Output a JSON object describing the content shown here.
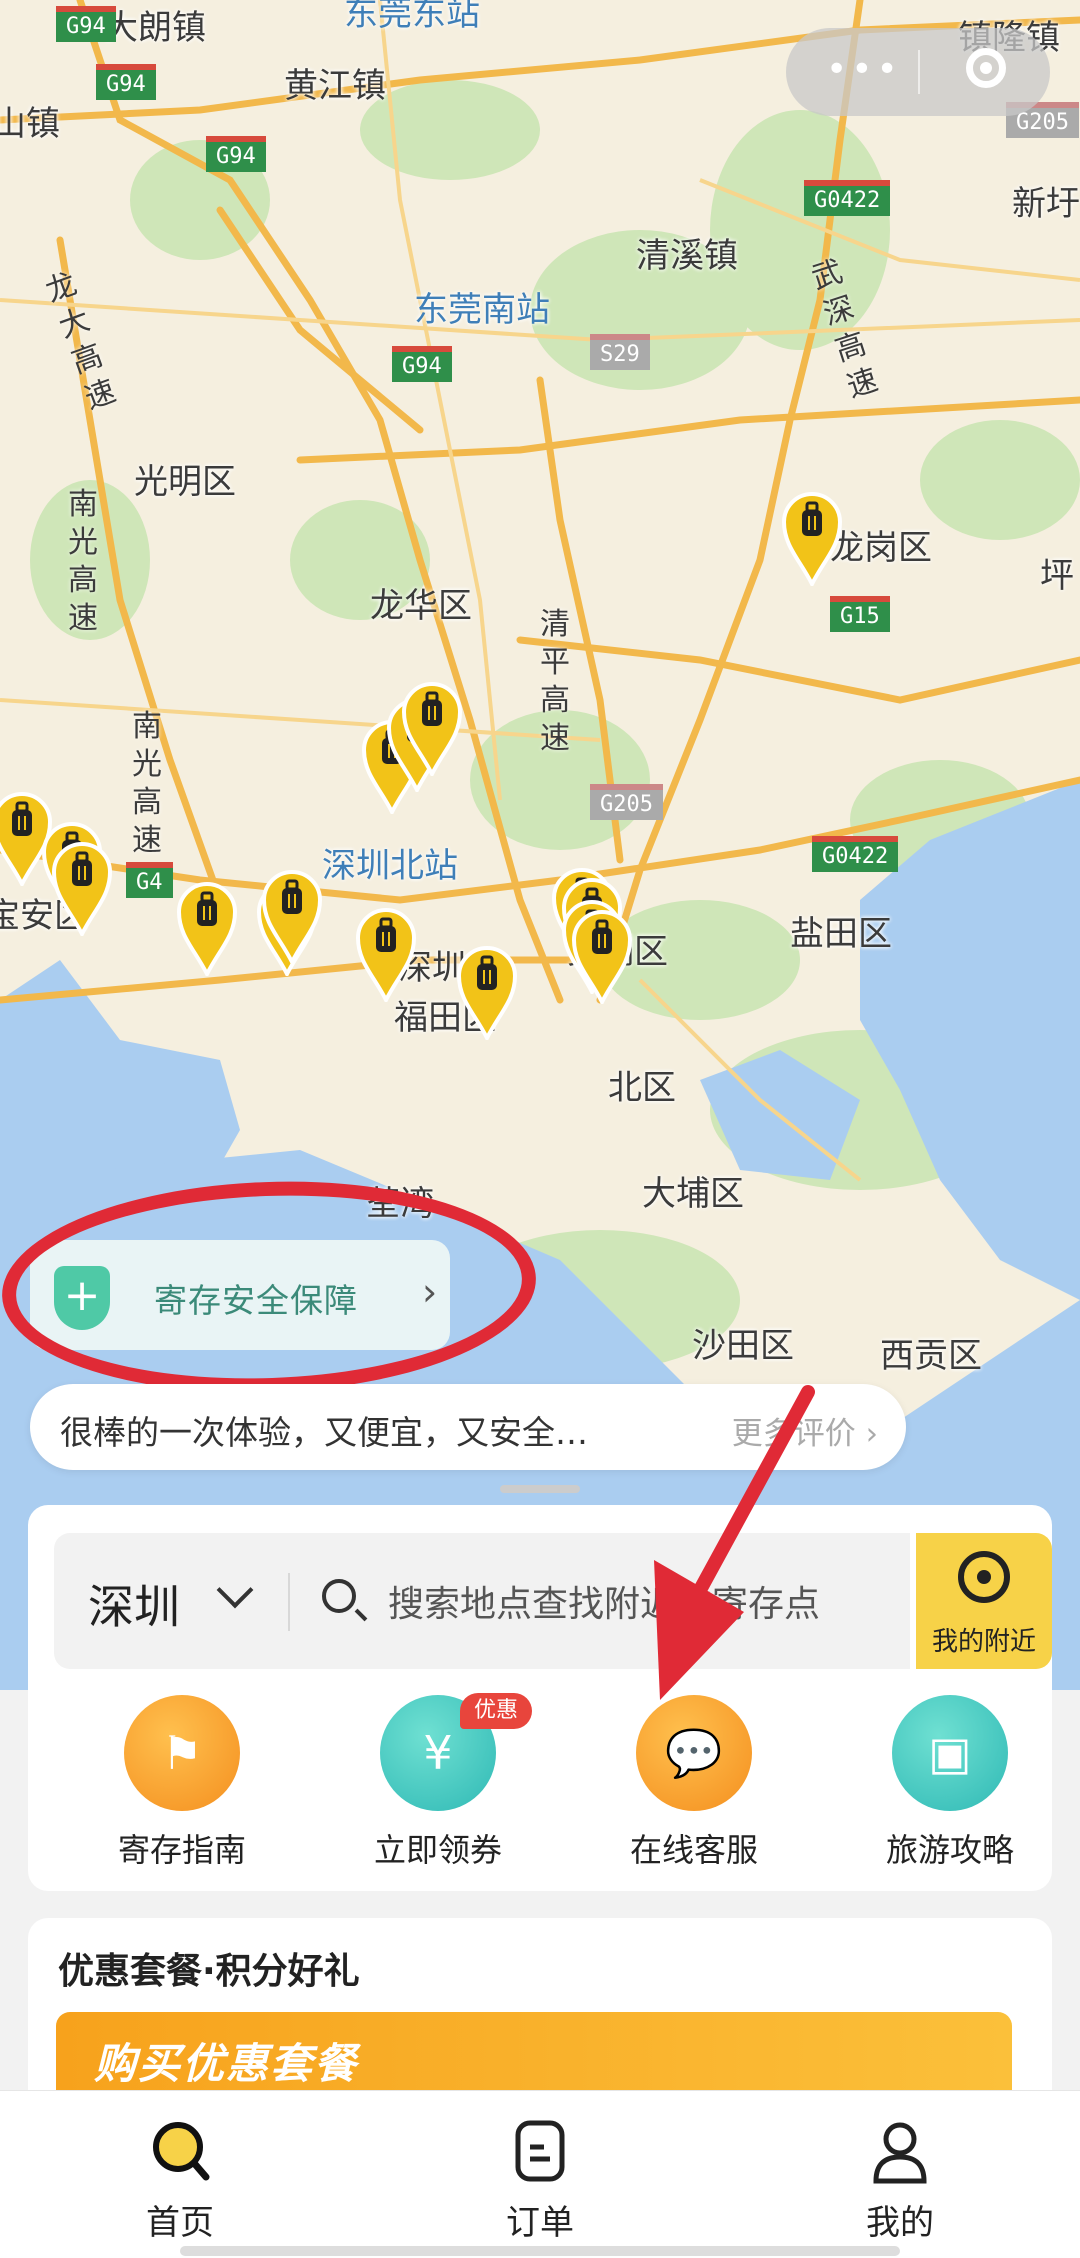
{
  "map": {
    "labels": [
      "大朗镇",
      "东莞东站",
      "镇隆镇",
      "山镇",
      "黄江镇",
      "新圩",
      "清溪镇",
      "东莞南站",
      "光明区",
      "龙岗区",
      "坪",
      "龙华区",
      "深圳北站",
      "宝安区",
      "罗湖区",
      "盐田区",
      "福田区",
      "深圳",
      "北区",
      "大埔区",
      "沙田区",
      "西贡区",
      "荃湾"
    ],
    "vertical_labels": [
      "龙大高速",
      "南光高速",
      "清平高速",
      "武深高速",
      "南光高速"
    ],
    "shields": [
      "G94",
      "G94",
      "G94",
      "G205",
      "G0422",
      "G94",
      "S29",
      "G15",
      "G205",
      "G0422",
      "G4"
    ],
    "pins": 16
  },
  "capsule": {
    "more_icon": "more-dots-icon",
    "close_icon": "target-close-icon"
  },
  "safety": {
    "label": "寄存安全保障",
    "icon": "shield-plus-icon"
  },
  "review": {
    "text": "很棒的一次体验，又便宜，又安全…",
    "more": "更多评价 ›"
  },
  "search": {
    "city": "深圳",
    "placeholder": "搜索地点查找附近的寄存点",
    "nearby_label": "我的附近"
  },
  "quick": [
    {
      "label": "寄存指南",
      "icon": "signpost-icon",
      "color": "#f9a23b"
    },
    {
      "label": "立即领券",
      "icon": "coupon-icon",
      "color": "#45c9c0",
      "badge": "优惠"
    },
    {
      "label": "在线客服",
      "icon": "chat-bubble-icon",
      "color": "#f7a634"
    },
    {
      "label": "旅游攻略",
      "icon": "guide-book-icon",
      "color": "#45c9c0"
    }
  ],
  "promo": {
    "heading": "优惠套餐·积分好礼",
    "banner_text": "购买优惠套餐"
  },
  "tabs": [
    {
      "label": "首页",
      "icon": "search-home-icon"
    },
    {
      "label": "订单",
      "icon": "order-icon"
    },
    {
      "label": "我的",
      "icon": "profile-icon"
    }
  ]
}
